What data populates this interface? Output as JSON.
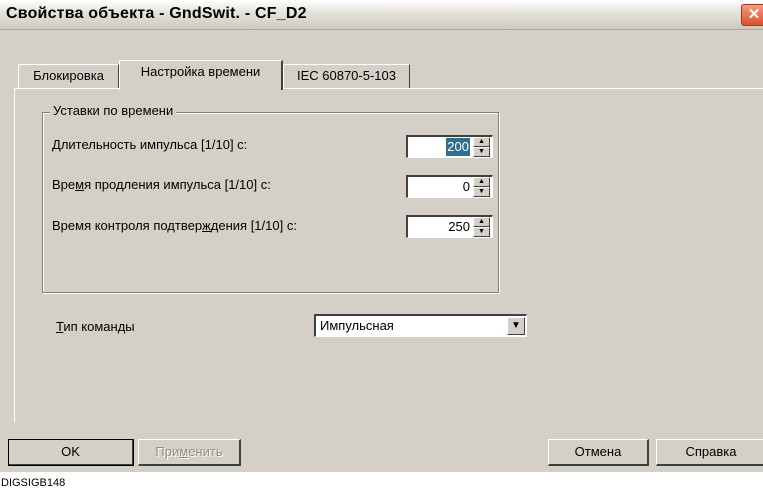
{
  "window": {
    "title": "Свойства объекта - GndSwit. - CF_D2",
    "close_symbol": "✕"
  },
  "tabs": [
    {
      "label": "Блокировка"
    },
    {
      "label": "Настройка времени",
      "active": true
    },
    {
      "label": "IEC 60870-5-103"
    }
  ],
  "group": {
    "legend": "Уставки по времени"
  },
  "fields": {
    "pulse_duration": {
      "label_accel": "Д",
      "label_rest": "лительность импульса [1/10] с:",
      "value": "200"
    },
    "pulse_extension": {
      "label_pre": "Вре",
      "label_accel": "м",
      "label_rest": "я продления импульса [1/10] с:",
      "value": "0"
    },
    "confirm_time": {
      "label_pre": "Время контроля подтвер",
      "label_accel": "ж",
      "label_rest": "дения [1/10] с:",
      "value": "250"
    }
  },
  "command_type": {
    "label_accel": "Т",
    "label_rest": "ип команды",
    "value": "Импульсная"
  },
  "buttons": {
    "ok": "OK",
    "apply_pre": "При",
    "apply_accel": "м",
    "apply_rest": "енить",
    "cancel": "Отмена",
    "help": "Справка"
  },
  "caption": "DIGSIGB148",
  "colors": {
    "selection": "#2f6f8f",
    "close_button": "#dd5030",
    "dialog_face": "#d4d0c8"
  }
}
